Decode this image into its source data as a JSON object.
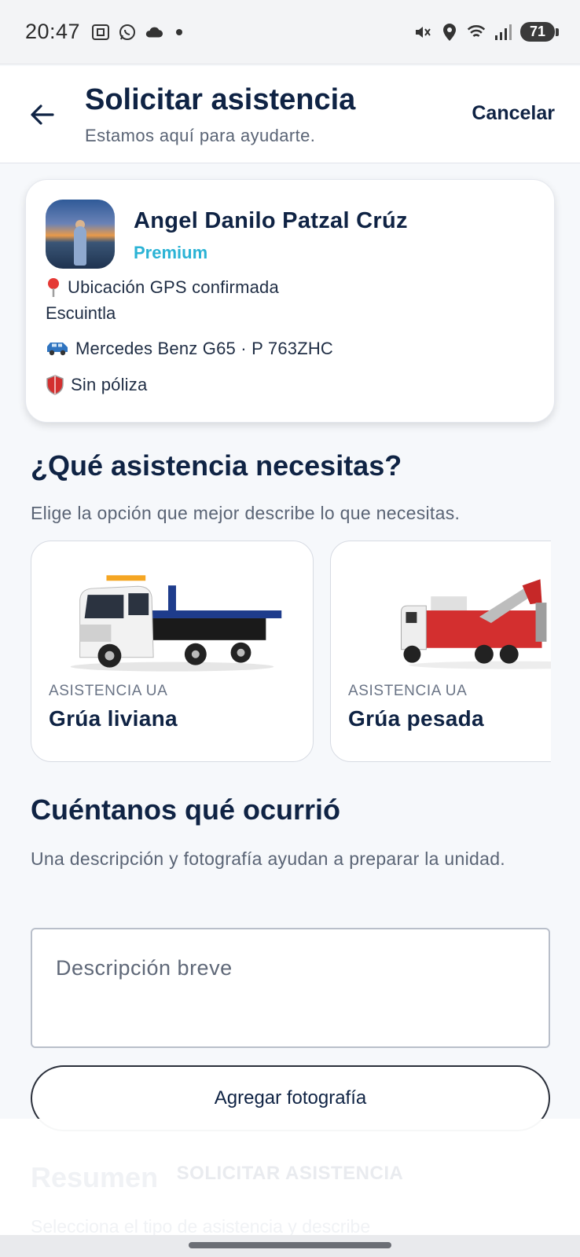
{
  "status_bar": {
    "time": "20:47",
    "battery": "71",
    "left_icons": [
      "screenshot-icon",
      "whatsapp-icon",
      "cloud-icon"
    ],
    "right_icons": [
      "mute-icon",
      "location-icon",
      "wifi-icon",
      "signal-icon"
    ]
  },
  "header": {
    "title": "Solicitar asistencia",
    "subtitle": "Estamos aquí para ayudarte.",
    "cancel_label": "Cancelar"
  },
  "profile": {
    "name": "Angel Danilo Patzal Crúz",
    "tier": "Premium",
    "location_label": "Ubicación GPS confirmada",
    "location_value": "Escuintla",
    "vehicle": "Mercedes Benz G65 · P 763ZHC",
    "policy": "Sin póliza",
    "colors": {
      "tier": "#2bb3d5"
    }
  },
  "assistance": {
    "title": "¿Qué asistencia necesitas?",
    "subtitle": "Elige la opción que mejor describe lo que necesitas.",
    "options": [
      {
        "tag": "ASISTENCIA UA",
        "label": "Grúa liviana",
        "image": "flatbed-tow-truck"
      },
      {
        "tag": "ASISTENCIA UA",
        "label": "Grúa pesada",
        "image": "heavy-wrecker-truck"
      }
    ]
  },
  "incident": {
    "title": "Cuéntanos qué ocurrió",
    "subtitle": "Una descripción y fotografía ayudan a preparar la unidad.",
    "description_placeholder": "Descripción breve",
    "photo_button": "Agregar fotografía"
  },
  "footer": {
    "submit_label": "SOLICITAR ASISTENCIA",
    "summary_title": "Resumen",
    "summary_sub": "Selecciona el tipo de asistencia y describe"
  }
}
